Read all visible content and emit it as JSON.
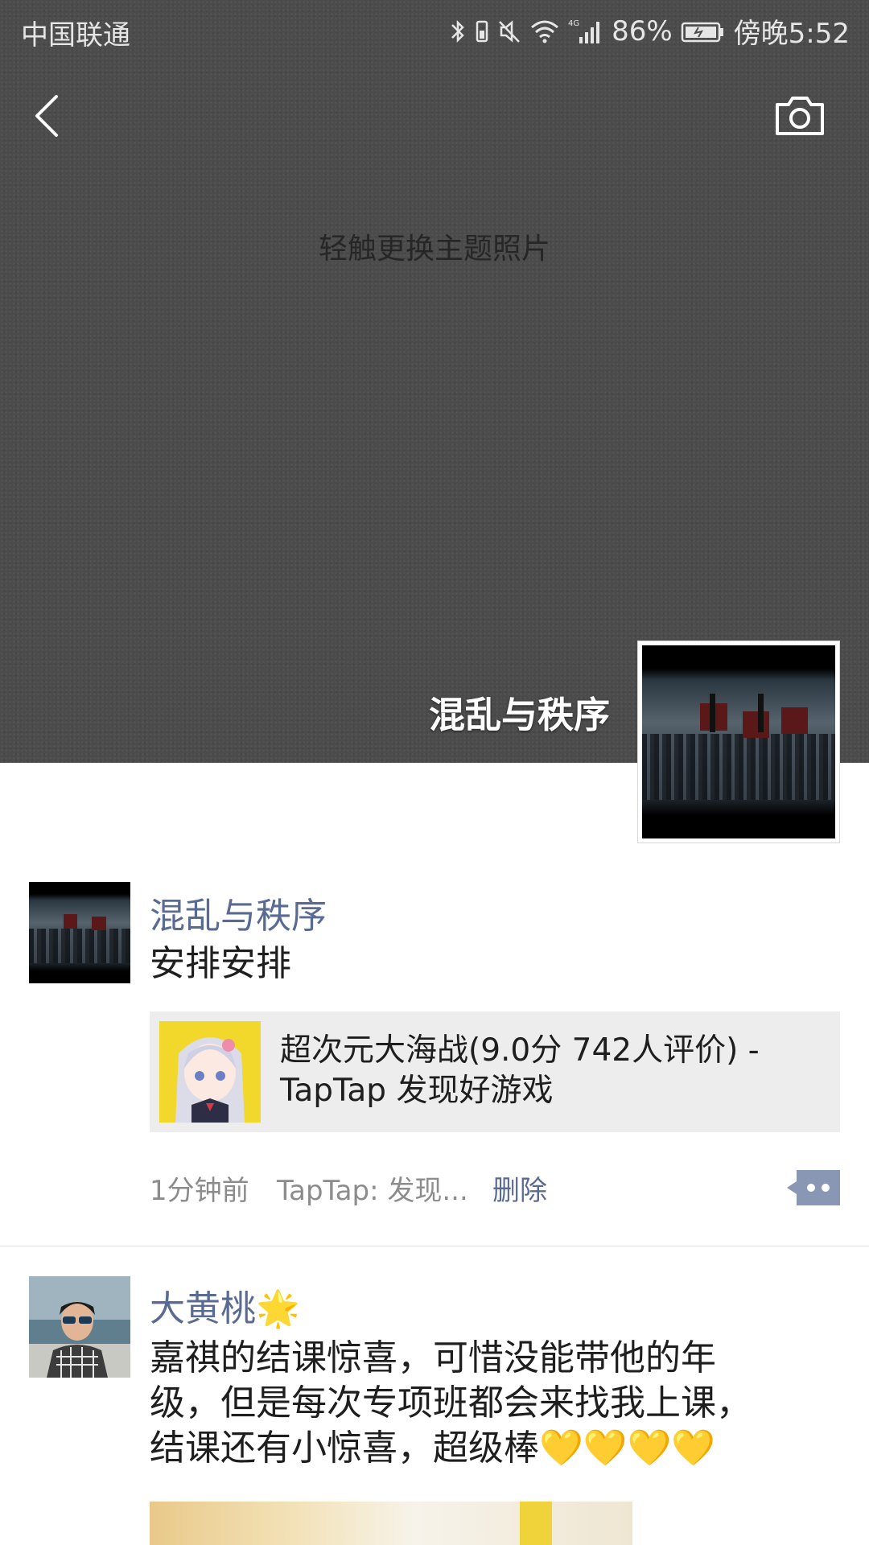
{
  "status_bar": {
    "carrier": "中国联通",
    "network": "4G",
    "battery": "86%",
    "time": "傍晚5:52"
  },
  "cover": {
    "hint": "轻触更换主题照片",
    "profile_name": "混乱与秩序"
  },
  "posts": [
    {
      "author": "混乱与秩序",
      "text": "安排安排",
      "link": {
        "title": "超次元大海战(9.0分 742人评价) - TapTap 发现好游戏"
      },
      "time": "1分钟前",
      "source": "TapTap: 发现...",
      "delete_label": "删除"
    },
    {
      "author": "大黄桃",
      "author_emoji": "🌟",
      "text_lines": [
        "嘉祺的结课惊喜，可惜没能带他的年",
        "级，但是每次专项班都会来找我上课，",
        "结课还有小惊喜，超级棒💛💛💛💛"
      ]
    }
  ],
  "colors": {
    "link_blue": "#5a6b93",
    "cover_bg": "#4b4b4b",
    "card_bg": "#ededed"
  }
}
